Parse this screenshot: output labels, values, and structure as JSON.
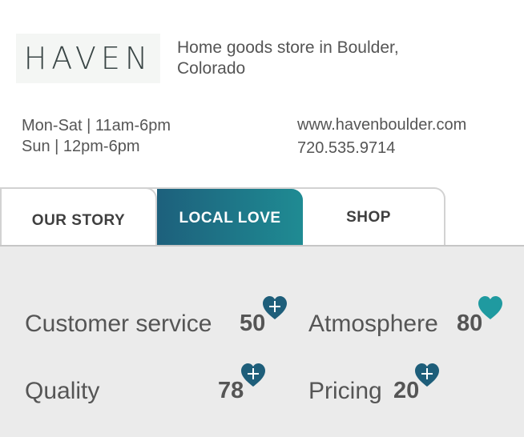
{
  "store": {
    "logo_text": "HAVEN",
    "tagline_line1": "Home goods store in Boulder,",
    "tagline_line2": "Colorado",
    "hours": [
      "Mon-Sat | 11am-6pm",
      "Sun | 12pm-6pm"
    ],
    "website": "www.havenboulder.com",
    "phone": "720.535.9714"
  },
  "tabs": [
    {
      "label": "OUR STORY",
      "active": false
    },
    {
      "label": "LOCAL LOVE",
      "active": true
    },
    {
      "label": "SHOP",
      "active": false
    }
  ],
  "ratings": [
    {
      "label": "Customer service",
      "value": "50",
      "icon": "heart-plus-icon"
    },
    {
      "label": "Atmosphere",
      "value": "80",
      "icon": "heart-icon"
    },
    {
      "label": "Quality",
      "value": "78",
      "icon": "heart-plus-icon"
    },
    {
      "label": "Pricing",
      "value": "20",
      "icon": "heart-plus-icon"
    }
  ],
  "colors": {
    "active_tab_start": "#1d607c",
    "active_tab_end": "#1f8b93",
    "heart_dark": "#1e5e7a",
    "heart_teal": "#1f9aa0",
    "panel_bg": "#ebebeb"
  }
}
